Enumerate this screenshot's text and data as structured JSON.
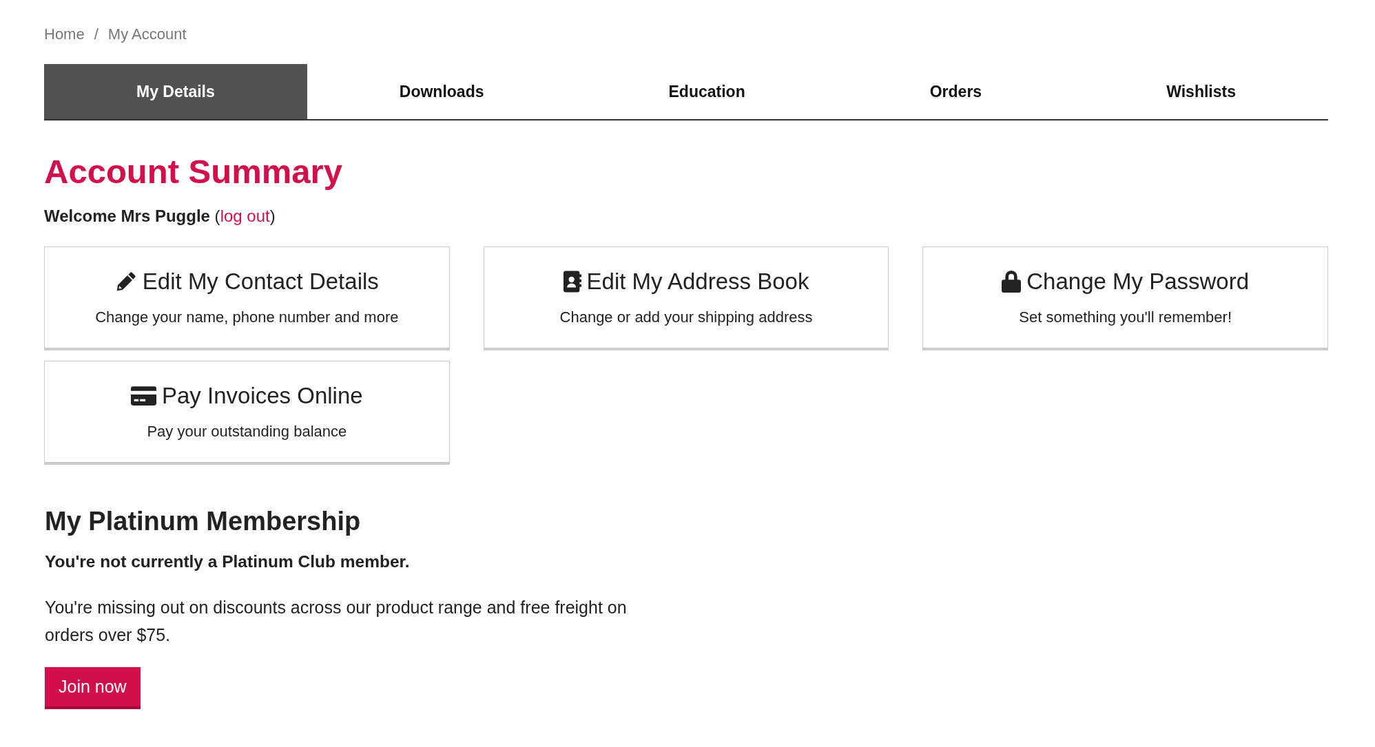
{
  "breadcrumb": {
    "items": [
      "Home",
      "My Account"
    ],
    "separator": "/"
  },
  "tabs": [
    {
      "label": "My Details",
      "selected": true
    },
    {
      "label": "Downloads",
      "selected": false
    },
    {
      "label": "Education",
      "selected": false
    },
    {
      "label": "Orders",
      "selected": false
    },
    {
      "label": "Wishlists",
      "selected": false
    }
  ],
  "heading": "Account Summary",
  "welcome": {
    "text_before": "**Welcome Mrs Puggle** (",
    "link": "log out",
    "text_after": ")"
  },
  "cards": [
    {
      "title": "Edit My Contact Details",
      "description": "Change your name, phone number and more"
    },
    {
      "title": "Edit My Address Book",
      "description": "Change or add your shipping address"
    },
    {
      "title": "Change My Password",
      "description": "Set something you'll remember!"
    },
    {
      "title": "Pay Invoices Online",
      "description": "Pay your outstanding balance"
    }
  ],
  "membership": {
    "heading": "My Platinum Membership",
    "status": "You're not currently a Platinum Club member.",
    "description": "You're missing out on discounts across our product range and free freight on orders over $75.",
    "button": "Join now"
  }
}
